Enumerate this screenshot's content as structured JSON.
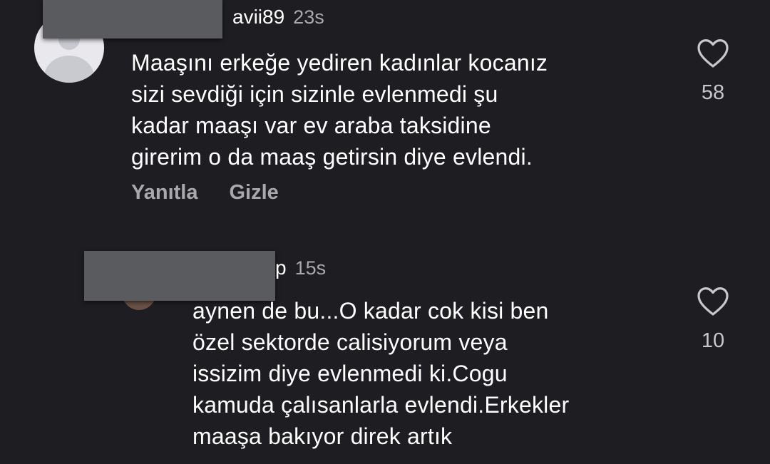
{
  "comments": [
    {
      "username": "avii89",
      "time": "23s",
      "text": "Maaşını erkeğe yediren kadınlar kocanız\nsizi sevdiği için sizinle evlenmedi şu\nkadar maaşı var ev araba taksidine\ngirerim o da maaş getirsin diye evlendi.",
      "like_count": "58",
      "actions": {
        "reply": "Yanıtla",
        "hide": "Gizle"
      }
    },
    {
      "username": "p",
      "time": "15s",
      "text": "aynen de bu...O kadar cok kisi ben\nözel sektorde calisiyorum veya\nissizim diye evlenmedi ki.Cogu\nkamuda çalısanlarla evlendi.Erkekler\nmaaşa bakıyor direk artık",
      "like_count": "10"
    }
  ],
  "icons": {
    "like": "heart-outline-icon",
    "avatar": "default-avatar-icon"
  },
  "colors": {
    "background": "#1e1e22",
    "text": "#ffffff",
    "muted": "#a8a8ad"
  }
}
